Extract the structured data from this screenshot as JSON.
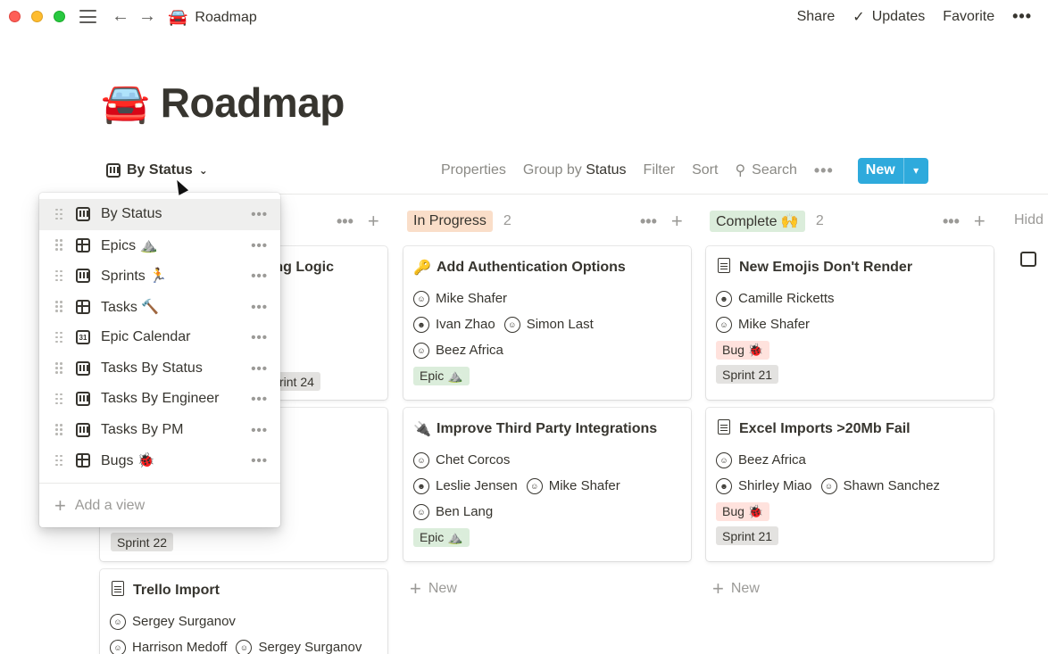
{
  "topbar": {
    "breadcrumb_emoji": "🚘",
    "breadcrumb_title": "Roadmap",
    "share": "Share",
    "updates": "Updates",
    "favorite": "Favorite",
    "more": "•••"
  },
  "page": {
    "emoji": "🚘",
    "title": "Roadmap"
  },
  "viewbar": {
    "current_view": "By Status",
    "properties": "Properties",
    "group_by_prefix": "Group by",
    "group_by_value": "Status",
    "filter": "Filter",
    "sort": "Sort",
    "search": "Search",
    "more": "•••",
    "new": "New"
  },
  "columns": {
    "in_progress": {
      "label": "In Progress",
      "count": "2"
    },
    "complete": {
      "label": "Complete 🙌",
      "count": "2"
    },
    "hidden": "Hidd"
  },
  "cards": {
    "c0": {
      "title_fragment": "ng Logic",
      "tag": "rint 24"
    },
    "c1": {
      "tag": "Sprint 22"
    },
    "c2": {
      "icon": "🔑",
      "title": "Add Authentication Options",
      "p1": "Mike Shafer",
      "p2a": "Ivan Zhao",
      "p2b": "Simon Last",
      "p3": "Beez Africa",
      "tag": "Epic ⛰️"
    },
    "c3": {
      "icon": "🔌",
      "title": "Improve Third Party Integrations",
      "p1": "Chet Corcos",
      "p2a": "Leslie Jensen",
      "p2b": "Mike Shafer",
      "p3": "Ben Lang",
      "tag": "Epic ⛰️"
    },
    "c4": {
      "title": "New Emojis Don't Render",
      "p1": "Camille Ricketts",
      "p2": "Mike Shafer",
      "tag1": "Bug 🐞",
      "tag2": "Sprint 21"
    },
    "c5": {
      "title": "Excel Imports >20Mb Fail",
      "p1": "Beez Africa",
      "p2a": "Shirley Miao",
      "p2b": "Shawn Sanchez",
      "tag1": "Bug 🐞",
      "tag2": "Sprint 21"
    },
    "c6": {
      "title": "Trello Import",
      "p1": "Sergey Surganov",
      "p2a": "Harrison Medoff",
      "p2b": "Sergey Surganov"
    }
  },
  "new_label": "New",
  "dropdown": {
    "items": [
      {
        "label": "By Status",
        "icon": "board-icon"
      },
      {
        "label": "Epics ⛰️",
        "icon": "table-icon"
      },
      {
        "label": "Sprints 🏃",
        "icon": "board-icon"
      },
      {
        "label": "Tasks 🔨",
        "icon": "table-icon"
      },
      {
        "label": "Epic Calendar",
        "icon": "calendar-icon"
      },
      {
        "label": "Tasks By Status",
        "icon": "board-icon"
      },
      {
        "label": "Tasks By Engineer",
        "icon": "board-icon"
      },
      {
        "label": "Tasks By PM",
        "icon": "board-icon"
      },
      {
        "label": "Bugs 🐞",
        "icon": "table-icon"
      }
    ],
    "more": "•••",
    "add_view": "Add a view"
  },
  "colors": {
    "accent": "#2eaadc",
    "in_progress_tag": "#fadec9",
    "complete_tag": "#dbeddb",
    "bug_tag": "#ffe2dd",
    "sprint_tag": "#e3e2e0"
  }
}
